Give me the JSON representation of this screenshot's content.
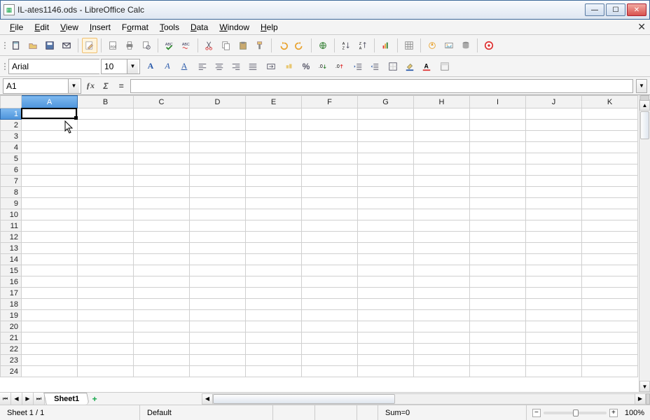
{
  "window": {
    "title": "IL-ates1146.ods - LibreOffice Calc"
  },
  "menu": {
    "items": [
      "File",
      "Edit",
      "View",
      "Insert",
      "Format",
      "Tools",
      "Data",
      "Window",
      "Help"
    ]
  },
  "format": {
    "font_name": "Arial",
    "font_size": "10"
  },
  "formula": {
    "cell_ref": "A1",
    "value": ""
  },
  "columns": [
    "A",
    "B",
    "C",
    "D",
    "E",
    "F",
    "G",
    "H",
    "I",
    "J",
    "K"
  ],
  "rows": [
    "1",
    "2",
    "3",
    "4",
    "5",
    "6",
    "7",
    "8",
    "9",
    "10",
    "11",
    "12",
    "13",
    "14",
    "15",
    "16",
    "17",
    "18",
    "19",
    "20",
    "21",
    "22",
    "23",
    "24"
  ],
  "selected": {
    "col": "A",
    "row": "1"
  },
  "tabs": {
    "active": "Sheet1"
  },
  "status": {
    "sheet_pos": "Sheet 1 / 1",
    "mode": "Default",
    "sum": "Sum=0",
    "zoom": "100%"
  }
}
